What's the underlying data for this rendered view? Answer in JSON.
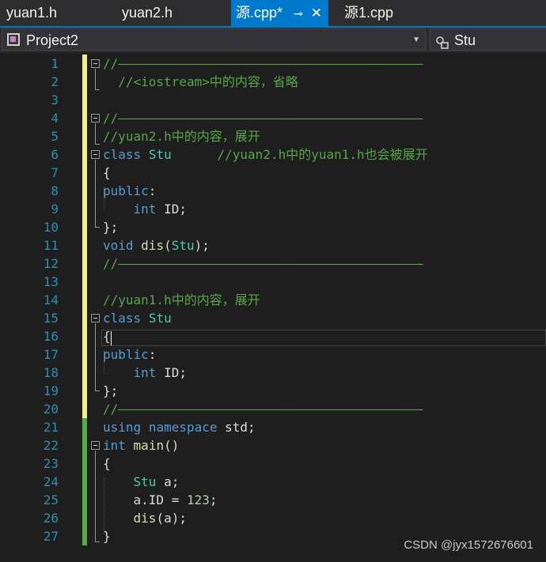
{
  "tabs": [
    {
      "label": "yuan1.h"
    },
    {
      "label": "yuan2.h"
    },
    {
      "label": "源.cpp*",
      "pin": "⊸",
      "close": "✕"
    },
    {
      "label": "源1.cpp"
    }
  ],
  "nav": {
    "project": "Project2",
    "scope": "Stu"
  },
  "line_numbers": [
    "1",
    "2",
    "3",
    "4",
    "5",
    "6",
    "7",
    "8",
    "9",
    "10",
    "11",
    "12",
    "13",
    "14",
    "15",
    "16",
    "17",
    "18",
    "19",
    "20",
    "21",
    "22",
    "23",
    "24",
    "25",
    "26",
    "27"
  ],
  "code": {
    "l1": {
      "c": "//————————————————————————————————————————"
    },
    "l2": {
      "c": "  //<iostream>中的内容，省略"
    },
    "l4": {
      "c": "//————————————————————————————————————————"
    },
    "l5": {
      "c": "//yuan2.h中的内容，展开"
    },
    "l6": {
      "k": "class",
      "sp": " ",
      "t": "Stu",
      "pad": "      ",
      "c": "//yuan2.h中的yuan1.h也会被展开"
    },
    "l7": {
      "p": "{"
    },
    "l8": {
      "k": "public",
      "p": ":"
    },
    "l9": {
      "ind": "    ",
      "k": "int",
      "p": " ID;"
    },
    "l10": {
      "p": "};"
    },
    "l11": {
      "k": "void",
      "sp": " ",
      "f": "dis",
      "p1": "(",
      "t": "Stu",
      "p2": ");"
    },
    "l12": {
      "c": "//————————————————————————————————————————"
    },
    "l14": {
      "c": "//yuan1.h中的内容，展开"
    },
    "l15": {
      "k": "class",
      "sp": " ",
      "t": "Stu"
    },
    "l16": {
      "p": "{"
    },
    "l17": {
      "k": "public",
      "p": ":"
    },
    "l18": {
      "ind": "    ",
      "k": "int",
      "p": " ID;"
    },
    "l19": {
      "p": "};"
    },
    "l20": {
      "c": "//————————————————————————————————————————"
    },
    "l21": {
      "k1": "using",
      "sp1": " ",
      "k2": "namespace",
      "p": " std;"
    },
    "l22": {
      "k": "int",
      "sp": " ",
      "f": "main",
      "p": "()"
    },
    "l23": {
      "p": "{"
    },
    "l24": {
      "ind": "    ",
      "t": "Stu",
      "p": " a;"
    },
    "l25": {
      "ind": "    ",
      "p1": "a.ID = ",
      "n": "123",
      "p2": ";"
    },
    "l26": {
      "ind": "    ",
      "f": "dis",
      "p": "(a);"
    },
    "l27": {
      "p": "}"
    }
  },
  "watermark": "CSDN @jyx1572676601",
  "colors": {
    "accent": "#007acc",
    "comment": "#57a64a",
    "keyword": "#569cd6",
    "type": "#4ec9b0",
    "function": "#dcdcaa",
    "number": "#b5cea8",
    "linenumber": "#2b91af"
  }
}
